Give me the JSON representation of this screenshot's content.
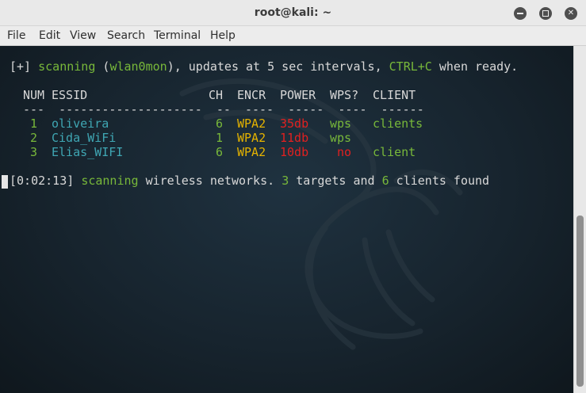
{
  "window": {
    "title": "root@kali: ~"
  },
  "menu": [
    "File",
    "Edit",
    "View",
    "Search",
    "Terminal",
    "Help"
  ],
  "terminal": {
    "scan_line": {
      "prefix": "[+] ",
      "scanning": "scanning",
      "open": " (",
      "iface": "wlan0mon",
      "rest": "), updates at 5 sec intervals, ",
      "ctrl": "CTRL+C",
      "when": " when ready."
    },
    "header": {
      "num": "NUM",
      "essid": "ESSID",
      "ch": "CH",
      "encr": "ENCR",
      "power": "POWER",
      "wps": "WPS?",
      "client": "CLIENT"
    },
    "separator": "---  --------------------  --  ----  -----  ----  ------",
    "rows": [
      {
        "num": "1",
        "essid": "oliveira",
        "ch": "6",
        "encr": "WPA2",
        "power": "35db",
        "wps": "wps",
        "client": "clients"
      },
      {
        "num": "2",
        "essid": "Cida_WiFi",
        "ch": "1",
        "encr": "WPA2",
        "power": "11db",
        "wps": "wps",
        "client": ""
      },
      {
        "num": "3",
        "essid": "Elias_WIFI",
        "ch": "6",
        "encr": "WPA2",
        "power": "10db",
        "wps": "no",
        "client": "client"
      }
    ],
    "status": {
      "time": "[0:02:13] ",
      "scanning": "scanning",
      "mid": " wireless networks. ",
      "targets": "3",
      "targets_label": " targets and ",
      "clients": "6",
      "clients_label": " clients found"
    }
  },
  "colors": {
    "green": "#78b83a",
    "cyan": "#3fa6b3",
    "yellow": "#e5b300",
    "red": "#e12020"
  }
}
